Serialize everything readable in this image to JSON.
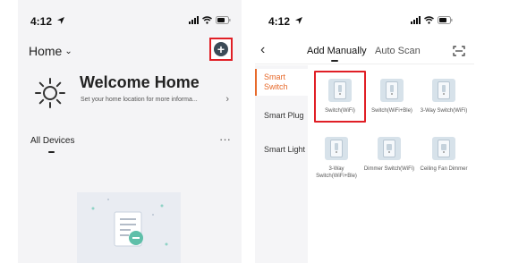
{
  "left_screen": {
    "status": {
      "time": "4:12"
    },
    "header": {
      "title": "Home",
      "add_button_icon": "+"
    },
    "welcome": {
      "title": "Welcome Home",
      "subtitle": "Set your home location for more informa...",
      "chevron": "›"
    },
    "devices": {
      "title": "All Devices",
      "more_label": "···"
    }
  },
  "right_screen": {
    "status": {
      "time": "4:12"
    },
    "nav": {
      "back_icon": "‹",
      "tab_manual": "Add Manually",
      "tab_auto": "Auto Scan"
    },
    "categories": [
      {
        "label": "Smart Switch",
        "active": true
      },
      {
        "label": "Smart Plug",
        "active": false
      },
      {
        "label": "Smart Light",
        "active": false
      }
    ],
    "products": [
      {
        "label": "Switch(WiFi)"
      },
      {
        "label": "Switch(WiFi+Ble)"
      },
      {
        "label": "3-Way Switch(WiFi)"
      },
      {
        "label": "3-Way Switch(WiFi+Ble)"
      },
      {
        "label": "Dimmer Switch(WiFi)"
      },
      {
        "label": "Ceiling Fan Dimmer"
      }
    ]
  },
  "colors": {
    "highlight": "#e01f26",
    "active_category": "#e76a2b",
    "add_button": "#3b4b57"
  }
}
